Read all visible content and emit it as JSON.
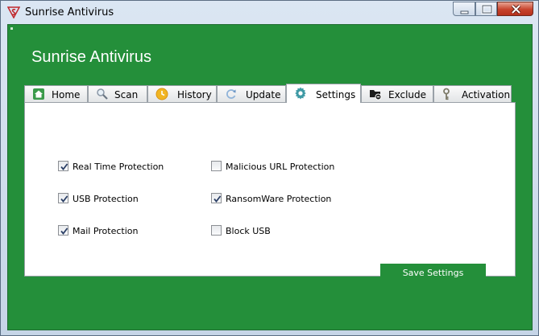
{
  "window": {
    "title": "Sunrise Antivirus",
    "icons": {
      "app": "sunrise-logo-icon",
      "minimize": "minimize-icon",
      "maximize": "maximize-icon",
      "close": "close-icon"
    }
  },
  "header": {
    "title": "Sunrise Antivirus"
  },
  "tabs": [
    {
      "label": "Home",
      "icon": "home-icon",
      "active": false
    },
    {
      "label": "Scan",
      "icon": "magnifier-icon",
      "active": false
    },
    {
      "label": "History",
      "icon": "history-icon",
      "active": false
    },
    {
      "label": "Update",
      "icon": "refresh-icon",
      "active": false
    },
    {
      "label": "Settings",
      "icon": "gear-icon",
      "active": true
    },
    {
      "label": "Exclude",
      "icon": "folder-exclude-icon",
      "active": false
    },
    {
      "label": "Activation",
      "icon": "key-icon",
      "active": false
    }
  ],
  "settings": {
    "options": [
      {
        "label": "Real Time Protection",
        "checked": true
      },
      {
        "label": "USB Protection",
        "checked": true
      },
      {
        "label": "Mail Protection",
        "checked": true
      },
      {
        "label": "Malicious URL Protection",
        "checked": false
      },
      {
        "label": "RansomWare Protection",
        "checked": true
      },
      {
        "label": "Block USB",
        "checked": false
      }
    ],
    "save_label": "Save Settings"
  },
  "colors": {
    "accent": "#248f3a",
    "panel": "#ffffff",
    "close_button": "#c7432c"
  }
}
